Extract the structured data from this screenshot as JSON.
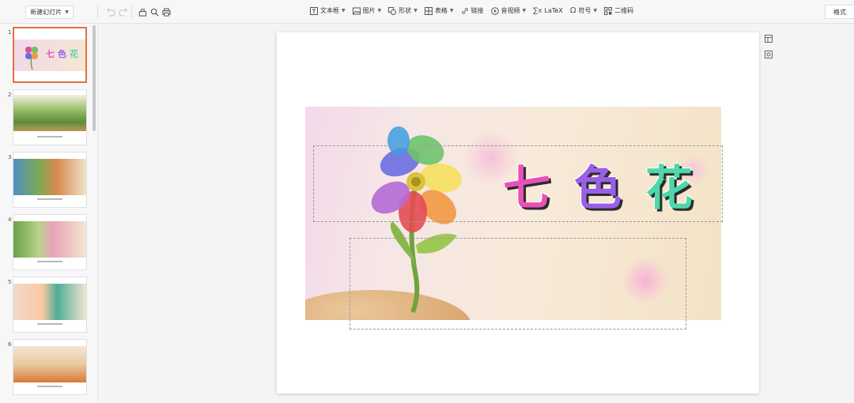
{
  "toolbar": {
    "new_slide_label": "新建幻灯片",
    "insert_tools": [
      {
        "label": "文本框",
        "icon": "textbox-icon",
        "has_dropdown": true
      },
      {
        "label": "图片",
        "icon": "image-icon",
        "has_dropdown": true
      },
      {
        "label": "形状",
        "icon": "shape-icon",
        "has_dropdown": true
      },
      {
        "label": "表格",
        "icon": "table-icon",
        "has_dropdown": true
      },
      {
        "label": "链接",
        "icon": "link-icon",
        "has_dropdown": false
      },
      {
        "label": "音视频",
        "icon": "media-icon",
        "has_dropdown": true
      },
      {
        "label": "LaTeX",
        "icon": "sigma-icon",
        "has_dropdown": false
      },
      {
        "label": "符号",
        "icon": "omega-icon",
        "has_dropdown": true
      },
      {
        "label": "二维码",
        "icon": "qrcode-icon",
        "has_dropdown": false
      }
    ],
    "format_tab_label": "格式"
  },
  "sidebar": {
    "slides": [
      {
        "number": "1",
        "active": true
      },
      {
        "number": "2",
        "active": false
      },
      {
        "number": "3",
        "active": false
      },
      {
        "number": "4",
        "active": false
      },
      {
        "number": "5",
        "active": false
      },
      {
        "number": "6",
        "active": false
      }
    ]
  },
  "slide": {
    "title_chars": [
      "七",
      "色",
      "花"
    ],
    "title_colors": [
      "#e852b8",
      "#9b5fe6",
      "#4fd6a9"
    ]
  }
}
